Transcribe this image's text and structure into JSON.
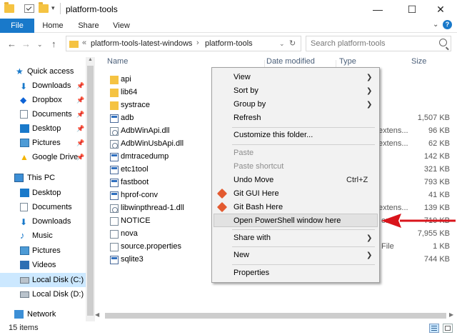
{
  "window": {
    "title": "platform-tools"
  },
  "ribbon": {
    "tabs": [
      "File",
      "Home",
      "Share",
      "View"
    ]
  },
  "address": {
    "overflow": "«",
    "crumbs": [
      "platform-tools-latest-windows",
      "platform-tools"
    ],
    "search_placeholder": "Search platform-tools"
  },
  "columns": {
    "name": "Name",
    "date": "Date modified",
    "type": "Type",
    "size": "Size"
  },
  "nav": {
    "quick_access": "Quick access",
    "quick_items": [
      "Downloads",
      "Dropbox",
      "Documents",
      "Desktop",
      "Pictures",
      "Google Drive"
    ],
    "this_pc": "This PC",
    "pc_items": [
      "Desktop",
      "Documents",
      "Downloads",
      "Music",
      "Pictures",
      "Videos",
      "Local Disk (C:)",
      "Local Disk (D:)"
    ],
    "network": "Network"
  },
  "files": [
    {
      "name": "api",
      "kind": "folder",
      "type": "",
      "size": ""
    },
    {
      "name": "lib64",
      "kind": "folder",
      "type": "",
      "size": ""
    },
    {
      "name": "systrace",
      "kind": "folder",
      "type": "",
      "size": ""
    },
    {
      "name": "adb",
      "kind": "exe",
      "type": "",
      "size": "1,507 KB"
    },
    {
      "name": "AdbWinApi.dll",
      "kind": "dll",
      "type": "extens...",
      "size": "96 KB"
    },
    {
      "name": "AdbWinUsbApi.dll",
      "kind": "dll",
      "type": "extens...",
      "size": "62 KB"
    },
    {
      "name": "dmtracedump",
      "kind": "exe",
      "type": "",
      "size": "142 KB"
    },
    {
      "name": "etc1tool",
      "kind": "exe",
      "type": "",
      "size": "321 KB"
    },
    {
      "name": "fastboot",
      "kind": "exe",
      "type": "",
      "size": "793 KB"
    },
    {
      "name": "hprof-conv",
      "kind": "exe",
      "type": "",
      "size": "41 KB"
    },
    {
      "name": "libwinpthread-1.dll",
      "kind": "dll",
      "type": "extens...",
      "size": "139 KB"
    },
    {
      "name": "NOTICE",
      "kind": "file",
      "type": "ent",
      "size": "710 KB"
    },
    {
      "name": "nova",
      "kind": "file",
      "type": "",
      "size": "7,955 KB"
    },
    {
      "name": "source.properties",
      "kind": "file",
      "type": "File",
      "size": "1 KB"
    },
    {
      "name": "sqlite3",
      "kind": "exe",
      "type": "",
      "size": "744 KB"
    }
  ],
  "context_menu": {
    "items": [
      {
        "label": "View",
        "submenu": true
      },
      {
        "label": "Sort by",
        "submenu": true
      },
      {
        "label": "Group by",
        "submenu": true
      },
      {
        "label": "Refresh"
      },
      {
        "label": "Customize this folder..."
      },
      {
        "label": "Paste",
        "disabled": true
      },
      {
        "label": "Paste shortcut",
        "disabled": true
      },
      {
        "label": "Undo Move",
        "shortcut": "Ctrl+Z"
      },
      {
        "label": "Git GUI Here",
        "icon": "git-icon"
      },
      {
        "label": "Git Bash Here",
        "icon": "git-icon"
      },
      {
        "label": "Open PowerShell window here",
        "highlighted": true
      },
      {
        "label": "Share with",
        "submenu": true
      },
      {
        "label": "New",
        "submenu": true
      },
      {
        "label": "Properties"
      }
    ]
  },
  "status": {
    "count": "15 items"
  },
  "colors": {
    "accent": "#1979ca",
    "folder": "#f5c342",
    "selected": "#cce8ff",
    "annotation_arrow": "#d9141b"
  }
}
